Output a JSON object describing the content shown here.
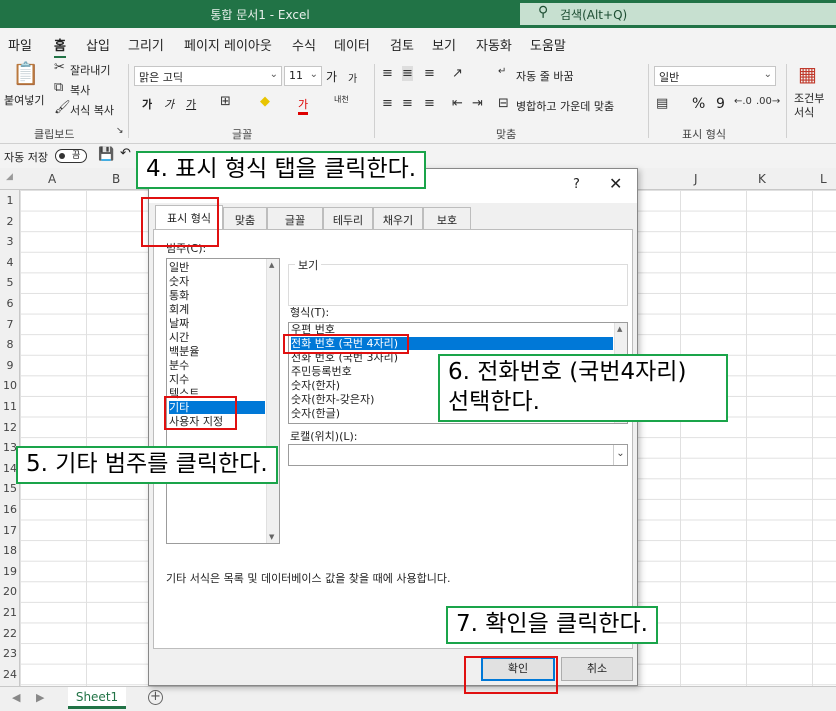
{
  "window": {
    "title": "통합 문서1  -  Excel",
    "search": "검색(Alt+Q)"
  },
  "menu": {
    "tabs": [
      "파일",
      "홈",
      "삽입",
      "그리기",
      "페이지 레이아웃",
      "수식",
      "데이터",
      "검토",
      "보기",
      "자동화",
      "도움말"
    ],
    "active": "홈"
  },
  "ribbon": {
    "clipboard": {
      "paste": "붙여넣기",
      "cut": "잘라내기",
      "copy": "복사",
      "format_painter": "서식 복사",
      "group": "클립보드"
    },
    "font": {
      "font_name": "맑은 고딕",
      "font_size": "11",
      "grow": "가",
      "shrink": "가",
      "bold": "가",
      "italic": "가",
      "underline": "가",
      "font_color": "가",
      "phonetic": "내천",
      "group": "글꼴"
    },
    "alignment": {
      "wrap_text": "자동 줄 바꿈",
      "merge": "병합하고 가운데 맞춤",
      "group": "맞춤"
    },
    "number": {
      "format": "일반",
      "percent": "%",
      "comma": "9",
      "group": "표시 형식"
    },
    "styles": {
      "conditional": "조건부",
      "conditional2": "서식"
    }
  },
  "qat": {
    "autosave": "자동 저장",
    "toggle": "끔"
  },
  "grid": {
    "columns": [
      "A",
      "B",
      "J",
      "K",
      "L"
    ],
    "rows": [
      "1",
      "2",
      "3",
      "4",
      "5",
      "6",
      "7",
      "8",
      "9",
      "10",
      "11",
      "12",
      "13",
      "14",
      "15",
      "16",
      "17",
      "18",
      "19",
      "20",
      "21",
      "22",
      "23",
      "24"
    ]
  },
  "sheet": {
    "tab": "Sheet1",
    "add": "+",
    "nav_prev": "◀",
    "nav_next": "▶"
  },
  "dialog": {
    "help": "?",
    "close": "✕",
    "tabs": [
      "표시 형식",
      "맞춤",
      "글꼴",
      "테두리",
      "채우기",
      "보호"
    ],
    "category_label": "범주(C):",
    "categories": [
      "일반",
      "숫자",
      "통화",
      "회계",
      "날짜",
      "시간",
      "백분율",
      "분수",
      "지수",
      "텍스트",
      "기타",
      "사용자 지정"
    ],
    "selected_category": "기타",
    "sample_label": "보기",
    "type_label": "형식(T):",
    "types": [
      "우편 번호",
      "전화 번호 (국번 4자리)",
      "전화 번호 (국번 3자리)",
      "주민등록번호",
      "숫자(한자)",
      "숫자(한자-갖은자)",
      "숫자(한글)"
    ],
    "selected_type": "전화 번호 (국번 4자리)",
    "locale_label": "로캘(위치)(L):",
    "locale_value": "",
    "description": "기타 서식은 목록 및 데이터베이스 값을 찾을 때에 사용합니다.",
    "ok": "확인",
    "cancel": "취소"
  },
  "annotations": {
    "step4": "4. 표시 형식 탭을 클릭한다.",
    "step5": "5. 기타 범주를 클릭한다.",
    "step6_line1": "6. 전화번호 (국번4자리)",
    "step6_line2": "선택한다.",
    "step7": "7. 확인을 클릭한다.",
    "callout_border": "#1aa44a",
    "highlight_border": "#e01010"
  }
}
